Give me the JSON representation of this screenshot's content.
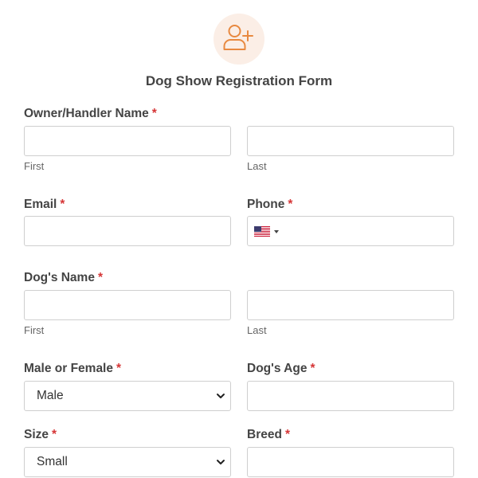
{
  "form": {
    "title": "Dog Show Registration Form",
    "required_mark": "*",
    "owner": {
      "label": "Owner/Handler Name",
      "first_sub": "First",
      "last_sub": "Last"
    },
    "email": {
      "label": "Email"
    },
    "phone": {
      "label": "Phone",
      "country_icon": "us-flag-icon"
    },
    "dog_name": {
      "label": "Dog's Name",
      "first_sub": "First",
      "last_sub": "Last"
    },
    "sex": {
      "label": "Male or Female",
      "value": "Male"
    },
    "age": {
      "label": "Dog's Age"
    },
    "size": {
      "label": "Size",
      "value": "Small"
    },
    "breed": {
      "label": "Breed"
    }
  },
  "colors": {
    "accent": "#e88940",
    "avatar_bg": "#fbeee6",
    "required": "#d63637",
    "border": "#cfcfcf"
  },
  "header_icon": "add-user-icon"
}
